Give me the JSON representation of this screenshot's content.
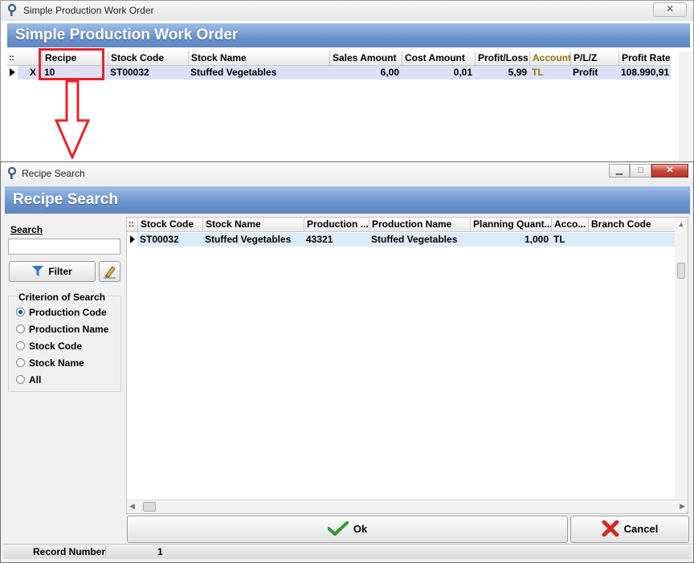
{
  "work_order_window": {
    "title": "Simple Production Work Order",
    "banner": "Simple Production Work Order",
    "close_glyph": "✕",
    "grid": {
      "columns": [
        "Recipe",
        "Stock Code",
        "Stock Name",
        "Sales Amount",
        "Cost Amount",
        "Profit/Loss",
        "Account",
        "P/L/Z",
        "Profit Rate"
      ],
      "grip": "::",
      "rows": [
        {
          "marker": "X",
          "recipe": "10",
          "stock_code": "ST00032",
          "stock_name": "Stuffed Vegetables",
          "sales_amount": "6,00",
          "cost_amount": "0,01",
          "profit_loss": "5,99",
          "account": "TL",
          "plz": "Profit",
          "profit_rate": "108.990,91"
        }
      ]
    }
  },
  "recipe_search_window": {
    "title": "Recipe Search",
    "banner": "Recipe Search",
    "search_label": "Search",
    "search_value": "",
    "filter_label": "Filter",
    "criterion_title": "Criterion of Search",
    "criteria": [
      {
        "label": "Production Code",
        "selected": true
      },
      {
        "label": "Production Name",
        "selected": false
      },
      {
        "label": "Stock Code",
        "selected": false
      },
      {
        "label": "Stock Name",
        "selected": false
      },
      {
        "label": "All",
        "selected": false
      }
    ],
    "grid": {
      "grip": "::",
      "columns": [
        "Stock Code",
        "Stock Name",
        "Production ...",
        "Production Name",
        "Planning Quant...",
        "Acco...",
        "Branch Code"
      ],
      "rows": [
        {
          "stock_code": "ST00032",
          "stock_name": "Stuffed Vegetables",
          "production_code": "43321",
          "production_name": "Stuffed Vegetables",
          "planning_quantity": "1,000",
          "account": "TL",
          "branch_code": ""
        }
      ]
    },
    "ok_label": "Ok",
    "cancel_label": "Cancel",
    "record_number_label": "Record Number",
    "record_number_value": "1"
  },
  "colors": {
    "banner": "#6a92cd",
    "highlight_red": "#e8222a",
    "account_header": "#8c7a12",
    "selected_row": "#dfe0f8"
  }
}
